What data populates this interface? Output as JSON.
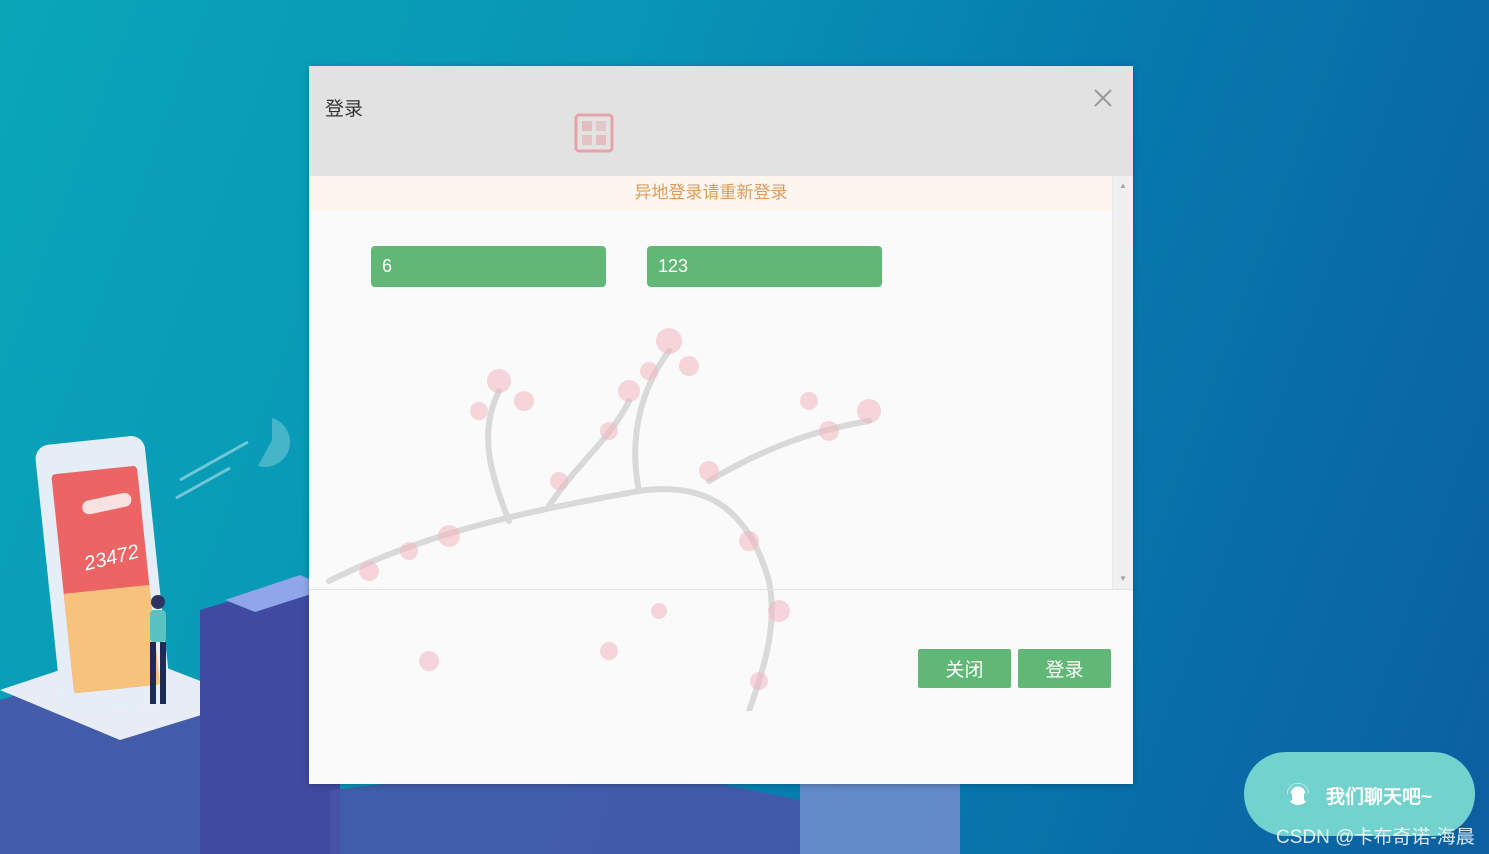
{
  "dialog": {
    "title": "登录",
    "notice": "异地登录请重新登录",
    "username_value": "6",
    "password_value": "123",
    "close_button_label": "关闭",
    "login_button_label": "登录"
  },
  "background_illustration": {
    "phone_number": "23472"
  },
  "chat_widget": {
    "label": "我们聊天吧~"
  },
  "watermark": {
    "text": "CSDN @卡布奇诺-海晨"
  },
  "colors": {
    "accent_green": "#61b775",
    "notice_text": "#e09b5a",
    "chat_widget": "#72d2cd",
    "background_teal": "#0aa6b8",
    "background_blue": "#0c5fa0"
  },
  "icons": {
    "close": "close-icon",
    "chat": "headset-icon",
    "seal": "seal-stamp-icon",
    "scroll_up": "triangle-up-icon",
    "scroll_down": "triangle-down-icon"
  }
}
